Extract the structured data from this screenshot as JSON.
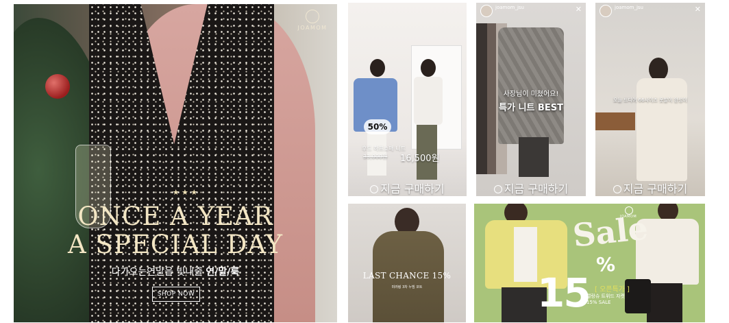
{
  "hero": {
    "brand": "JOAMOM",
    "headline_line1": "ONCE A YEAR",
    "headline_line2": "A SPECIAL DAY",
    "subtitle_prefix": "다가오는연말을 빛내줄 ",
    "subtitle_bold": "연/말/룩",
    "cta": "SHOP NOW",
    "stars": "★ ★ ★"
  },
  "story1": {
    "badge": "50%",
    "product_name": "후드 하프소매 니트",
    "old_price": "33,000원",
    "new_price": "16,500원",
    "cta": "지금 구매하기"
  },
  "story2": {
    "account": "joamom_jsu",
    "caption_line1": "사장님이 미쳤어요!",
    "caption_line2": "특가 니트 BEST",
    "cta": "지금 구매하기"
  },
  "story3": {
    "account": "joamom_jsu",
    "caption": "오늘 드디어 66사이즈 옷발이 완성이",
    "cta": "지금 구매하기"
  },
  "banner_last": {
    "headline": "LAST CHANCE 15%",
    "small_text": "미러링 3차 누빔 코트"
  },
  "banner_sale": {
    "brand": "JOAMOM",
    "word": "Sale",
    "percent_sign": "%",
    "number": "15",
    "tag": "[ 오픈특가 ]",
    "line1": "캘랑슈 트위드 자켓",
    "line2": "15% SALE"
  }
}
